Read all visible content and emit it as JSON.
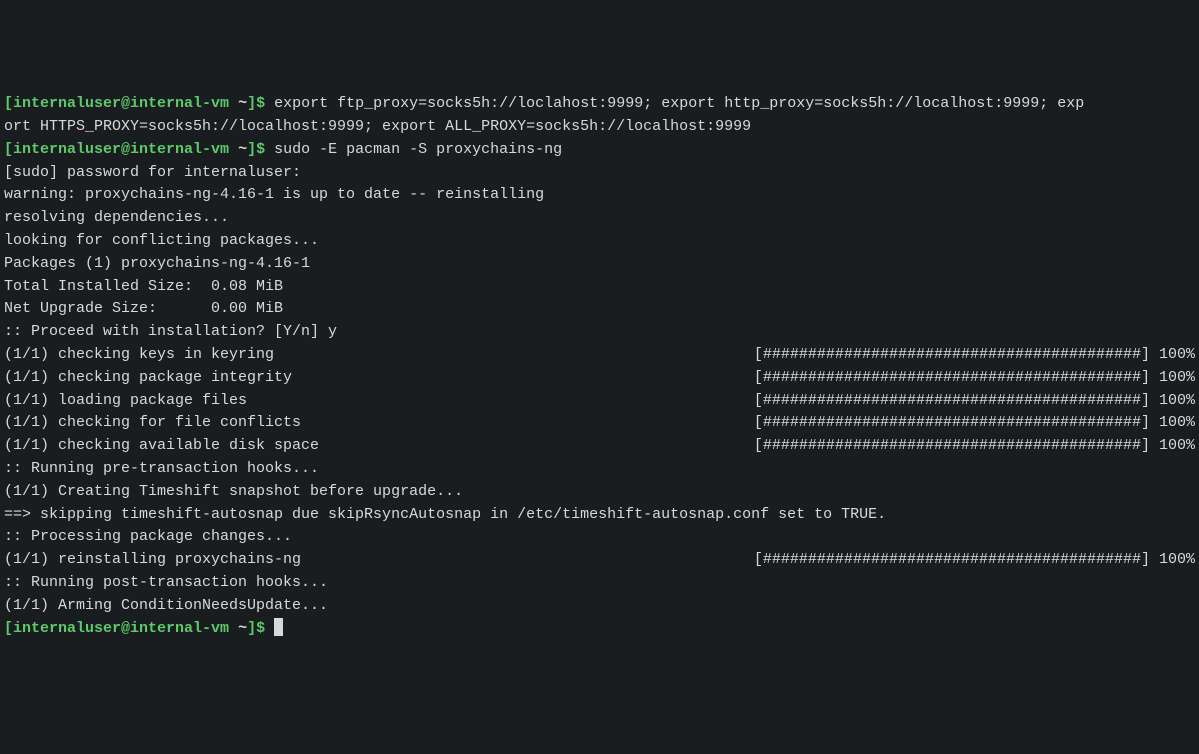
{
  "prompts": [
    {
      "user": "internaluser@internal-vm",
      "path": "~",
      "command": "export ftp_proxy=socks5h://loclahost:9999; export http_proxy=socks5h://localhost:9999; exp"
    },
    {
      "continuation": "ort HTTPS_PROXY=socks5h://localhost:9999; export ALL_PROXY=socks5h://localhost:9999"
    },
    {
      "user": "internaluser@internal-vm",
      "path": "~",
      "command": "sudo -E pacman -S proxychains-ng"
    }
  ],
  "output_lines": [
    "[sudo] password for internaluser:",
    "warning: proxychains-ng-4.16-1 is up to date -- reinstalling",
    "resolving dependencies...",
    "looking for conflicting packages...",
    "",
    "Packages (1) proxychains-ng-4.16-1",
    "",
    "Total Installed Size:  0.08 MiB",
    "Net Upgrade Size:      0.00 MiB",
    "",
    ":: Proceed with installation? [Y/n] y"
  ],
  "progress_lines": [
    {
      "left": "(1/1) checking keys in keyring",
      "right": "[##########################################] 100%"
    },
    {
      "left": "(1/1) checking package integrity",
      "right": "[##########################################] 100%"
    },
    {
      "left": "(1/1) loading package files",
      "right": "[##########################################] 100%"
    },
    {
      "left": "(1/1) checking for file conflicts",
      "right": "[##########################################] 100%"
    },
    {
      "left": "(1/1) checking available disk space",
      "right": "[##########################################] 100%"
    }
  ],
  "post_progress": [
    ":: Running pre-transaction hooks...",
    "(1/1) Creating Timeshift snapshot before upgrade...",
    "==> skipping timeshift-autosnap due skipRsyncAutosnap in /etc/timeshift-autosnap.conf set to TRUE.",
    ":: Processing package changes..."
  ],
  "reinstall_progress": {
    "left": "(1/1) reinstalling proxychains-ng",
    "right": "[##########################################] 100%"
  },
  "final_lines": [
    ":: Running post-transaction hooks...",
    "(1/1) Arming ConditionNeedsUpdate..."
  ],
  "final_prompt": {
    "user": "internaluser@internal-vm",
    "path": "~"
  }
}
